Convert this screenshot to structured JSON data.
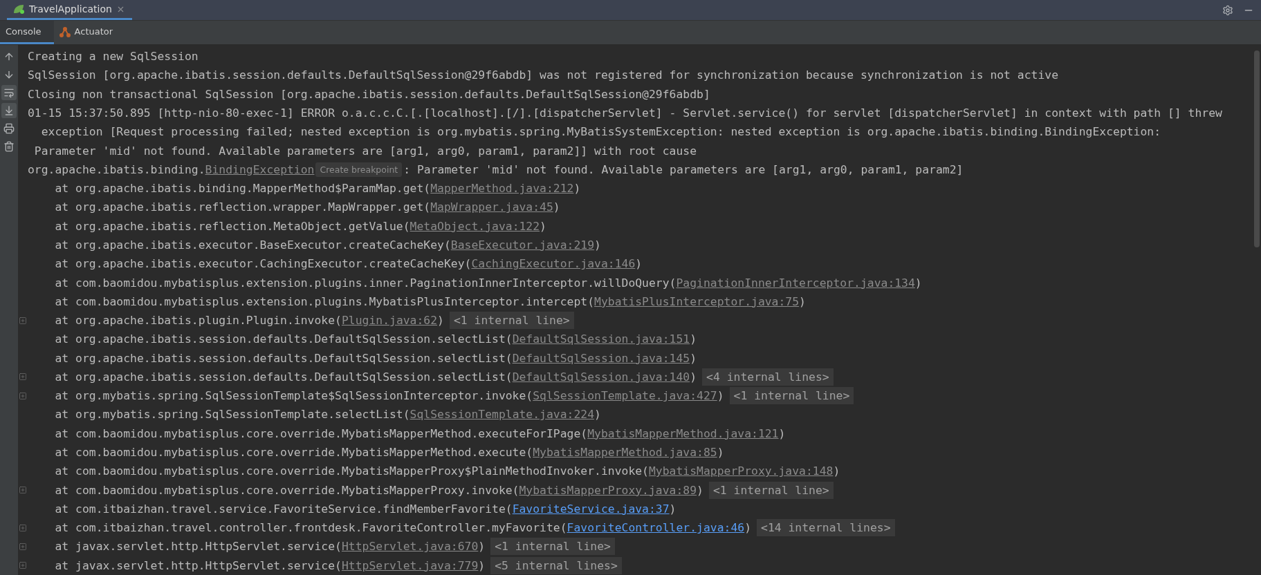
{
  "run_tabs": [
    {
      "label": "TravelApplication",
      "selected": true
    }
  ],
  "console_tabs": [
    {
      "label": "Console",
      "kind": "console",
      "selected": true
    },
    {
      "label": "Actuator",
      "kind": "actuator",
      "selected": false
    }
  ],
  "toolbar": [
    {
      "kind": "up",
      "on": false
    },
    {
      "kind": "down",
      "on": false
    },
    {
      "kind": "wrap",
      "on": true
    },
    {
      "kind": "scroll-end",
      "on": true
    },
    {
      "kind": "print",
      "on": false
    },
    {
      "kind": "trash",
      "on": false
    }
  ],
  "lines": [
    {
      "kind": "message",
      "folded": false,
      "segments": [
        {
          "kind": "plain",
          "text": "Creating a new SqlSession"
        }
      ]
    },
    {
      "kind": "message",
      "folded": false,
      "segments": [
        {
          "kind": "plain",
          "text": "SqlSession [org.apache.ibatis.session.defaults.DefaultSqlSession@29f6abdb] was not registered for synchronization because synchronization is not active"
        }
      ]
    },
    {
      "kind": "message",
      "folded": false,
      "segments": [
        {
          "kind": "plain",
          "text": "Closing non transactional SqlSession [org.apache.ibatis.session.defaults.DefaultSqlSession@29f6abdb]"
        }
      ]
    },
    {
      "kind": "message",
      "folded": false,
      "segments": [
        {
          "kind": "plain",
          "text": "01-15 15:37:50.895 [http-nio-80-exec-1] ERROR o.a.c.c.C.[.[localhost].[/].[dispatcherServlet] - Servlet.service() for servlet [dispatcherServlet] in context with path [] threw"
        }
      ]
    },
    {
      "kind": "wrap",
      "folded": false,
      "segments": [
        {
          "kind": "plain",
          "text": "exception [Request processing failed; nested exception is org.mybatis.spring.MyBatisSystemException: nested exception is org.apache.ibatis.binding.BindingException:"
        }
      ]
    },
    {
      "kind": "wrap-short",
      "folded": false,
      "segments": [
        {
          "kind": "plain",
          "text": "Parameter 'mid' not found. Available parameters are [arg1, arg0, param1, param2]] with root cause"
        }
      ]
    },
    {
      "kind": "message",
      "folded": false,
      "segments": [
        {
          "kind": "plain",
          "text": "org.apache.ibatis.binding."
        },
        {
          "kind": "source",
          "text": "BindingException"
        },
        {
          "kind": "hint",
          "text": "Create breakpoint"
        },
        {
          "kind": "plain",
          "text": ": Parameter 'mid' not found. Available parameters are [arg1, arg0, param1, param2]"
        }
      ]
    },
    {
      "kind": "frame",
      "folded": false,
      "segments": [
        {
          "kind": "plain",
          "text": "at org.apache.ibatis.binding.MapperMethod$ParamMap.get("
        },
        {
          "kind": "source",
          "text": "MapperMethod.java:212"
        },
        {
          "kind": "plain",
          "text": ")"
        }
      ]
    },
    {
      "kind": "frame",
      "folded": false,
      "segments": [
        {
          "kind": "plain",
          "text": "at org.apache.ibatis.reflection.wrapper.MapWrapper.get("
        },
        {
          "kind": "source",
          "text": "MapWrapper.java:45"
        },
        {
          "kind": "plain",
          "text": ")"
        }
      ]
    },
    {
      "kind": "frame",
      "folded": false,
      "segments": [
        {
          "kind": "plain",
          "text": "at org.apache.ibatis.reflection.MetaObject.getValue("
        },
        {
          "kind": "source",
          "text": "MetaObject.java:122"
        },
        {
          "kind": "plain",
          "text": ")"
        }
      ]
    },
    {
      "kind": "frame",
      "folded": false,
      "segments": [
        {
          "kind": "plain",
          "text": "at org.apache.ibatis.executor.BaseExecutor.createCacheKey("
        },
        {
          "kind": "source",
          "text": "BaseExecutor.java:219"
        },
        {
          "kind": "plain",
          "text": ")"
        }
      ]
    },
    {
      "kind": "frame",
      "folded": false,
      "segments": [
        {
          "kind": "plain",
          "text": "at org.apache.ibatis.executor.CachingExecutor.createCacheKey("
        },
        {
          "kind": "source",
          "text": "CachingExecutor.java:146"
        },
        {
          "kind": "plain",
          "text": ")"
        }
      ]
    },
    {
      "kind": "frame",
      "folded": false,
      "segments": [
        {
          "kind": "plain",
          "text": "at com.baomidou.mybatisplus.extension.plugins.inner.PaginationInnerInterceptor.willDoQuery("
        },
        {
          "kind": "source",
          "text": "PaginationInnerInterceptor.java:134"
        },
        {
          "kind": "plain",
          "text": ")"
        }
      ]
    },
    {
      "kind": "frame",
      "folded": false,
      "segments": [
        {
          "kind": "plain",
          "text": "at com.baomidou.mybatisplus.extension.plugins.MybatisPlusInterceptor.intercept("
        },
        {
          "kind": "source",
          "text": "MybatisPlusInterceptor.java:75"
        },
        {
          "kind": "plain",
          "text": ")"
        }
      ]
    },
    {
      "kind": "frame",
      "folded": true,
      "segments": [
        {
          "kind": "plain",
          "text": "at org.apache.ibatis.plugin.Plugin.invoke("
        },
        {
          "kind": "source",
          "text": "Plugin.java:62"
        },
        {
          "kind": "plain",
          "text": ")"
        },
        {
          "kind": "internal",
          "text": "<1 internal line>"
        }
      ]
    },
    {
      "kind": "frame",
      "folded": false,
      "segments": [
        {
          "kind": "plain",
          "text": "at org.apache.ibatis.session.defaults.DefaultSqlSession.selectList("
        },
        {
          "kind": "source",
          "text": "DefaultSqlSession.java:151"
        },
        {
          "kind": "plain",
          "text": ")"
        }
      ]
    },
    {
      "kind": "frame",
      "folded": false,
      "segments": [
        {
          "kind": "plain",
          "text": "at org.apache.ibatis.session.defaults.DefaultSqlSession.selectList("
        },
        {
          "kind": "source",
          "text": "DefaultSqlSession.java:145"
        },
        {
          "kind": "plain",
          "text": ")"
        }
      ]
    },
    {
      "kind": "frame",
      "folded": true,
      "segments": [
        {
          "kind": "plain",
          "text": "at org.apache.ibatis.session.defaults.DefaultSqlSession.selectList("
        },
        {
          "kind": "source",
          "text": "DefaultSqlSession.java:140"
        },
        {
          "kind": "plain",
          "text": ")"
        },
        {
          "kind": "internal",
          "text": "<4 internal lines>"
        }
      ]
    },
    {
      "kind": "frame",
      "folded": true,
      "segments": [
        {
          "kind": "plain",
          "text": "at org.mybatis.spring.SqlSessionTemplate$SqlSessionInterceptor.invoke("
        },
        {
          "kind": "source",
          "text": "SqlSessionTemplate.java:427"
        },
        {
          "kind": "plain",
          "text": ")"
        },
        {
          "kind": "internal",
          "text": "<1 internal line>"
        }
      ]
    },
    {
      "kind": "frame",
      "folded": false,
      "segments": [
        {
          "kind": "plain",
          "text": "at org.mybatis.spring.SqlSessionTemplate.selectList("
        },
        {
          "kind": "source",
          "text": "SqlSessionTemplate.java:224"
        },
        {
          "kind": "plain",
          "text": ")"
        }
      ]
    },
    {
      "kind": "frame",
      "folded": false,
      "segments": [
        {
          "kind": "plain",
          "text": "at com.baomidou.mybatisplus.core.override.MybatisMapperMethod.executeForIPage("
        },
        {
          "kind": "source",
          "text": "MybatisMapperMethod.java:121"
        },
        {
          "kind": "plain",
          "text": ")"
        }
      ]
    },
    {
      "kind": "frame",
      "folded": false,
      "segments": [
        {
          "kind": "plain",
          "text": "at com.baomidou.mybatisplus.core.override.MybatisMapperMethod.execute("
        },
        {
          "kind": "source",
          "text": "MybatisMapperMethod.java:85"
        },
        {
          "kind": "plain",
          "text": ")"
        }
      ]
    },
    {
      "kind": "frame",
      "folded": false,
      "segments": [
        {
          "kind": "plain",
          "text": "at com.baomidou.mybatisplus.core.override.MybatisMapperProxy$PlainMethodInvoker.invoke("
        },
        {
          "kind": "source",
          "text": "MybatisMapperProxy.java:148"
        },
        {
          "kind": "plain",
          "text": ")"
        }
      ]
    },
    {
      "kind": "frame",
      "folded": true,
      "segments": [
        {
          "kind": "plain",
          "text": "at com.baomidou.mybatisplus.core.override.MybatisMapperProxy.invoke("
        },
        {
          "kind": "source",
          "text": "MybatisMapperProxy.java:89"
        },
        {
          "kind": "plain",
          "text": ")"
        },
        {
          "kind": "internal",
          "text": "<1 internal line>"
        }
      ]
    },
    {
      "kind": "frame",
      "folded": false,
      "segments": [
        {
          "kind": "plain",
          "text": "at com.itbaizhan.travel.service.FavoriteService.findMemberFavorite("
        },
        {
          "kind": "project",
          "text": "FavoriteService.java:37"
        },
        {
          "kind": "plain",
          "text": ")"
        }
      ]
    },
    {
      "kind": "frame",
      "folded": true,
      "segments": [
        {
          "kind": "plain",
          "text": "at com.itbaizhan.travel.controller.frontdesk.FavoriteController.myFavorite("
        },
        {
          "kind": "project",
          "text": "FavoriteController.java:46"
        },
        {
          "kind": "plain",
          "text": ")"
        },
        {
          "kind": "internal",
          "text": "<14 internal lines>"
        }
      ]
    },
    {
      "kind": "frame",
      "folded": true,
      "segments": [
        {
          "kind": "plain",
          "text": "at javax.servlet.http.HttpServlet.service("
        },
        {
          "kind": "source",
          "text": "HttpServlet.java:670"
        },
        {
          "kind": "plain",
          "text": ")"
        },
        {
          "kind": "internal",
          "text": "<1 internal line>"
        }
      ]
    },
    {
      "kind": "frame",
      "folded": true,
      "segments": [
        {
          "kind": "plain",
          "text": "at javax.servlet.http.HttpServlet.service("
        },
        {
          "kind": "source",
          "text": "HttpServlet.java:779"
        },
        {
          "kind": "plain",
          "text": ")"
        },
        {
          "kind": "internal",
          "text": "<5 internal lines>"
        }
      ]
    }
  ]
}
